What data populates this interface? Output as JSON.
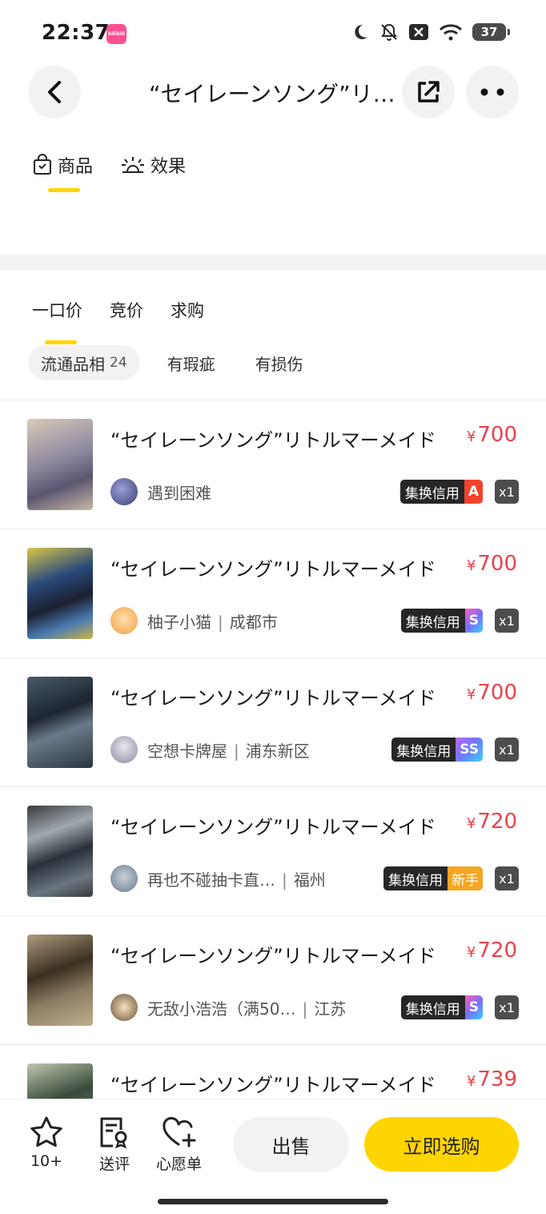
{
  "status_bar": {
    "time": "22:37",
    "app_badge": "bilibili",
    "battery": "37"
  },
  "header": {
    "title": "“セイレーンソング”リトルマーメイド"
  },
  "top_tabs": [
    {
      "label": "商品",
      "icon": "bag-icon",
      "active": true
    },
    {
      "label": "效果",
      "icon": "effect-icon",
      "active": false
    }
  ],
  "sub_tabs": [
    {
      "label": "一口价",
      "active": true
    },
    {
      "label": "竞价",
      "active": false
    },
    {
      "label": "求购",
      "active": false
    }
  ],
  "filters": [
    {
      "label": "流通品相",
      "count": "24",
      "active": true
    },
    {
      "label": "有瑕疵",
      "active": false
    },
    {
      "label": "有损伤",
      "active": false
    }
  ],
  "listings": [
    {
      "title": "“セイレーンソング”リトルマーメイド",
      "price": "700",
      "currency": "¥",
      "seller": "遇到困难",
      "location": "",
      "credit_label": "集换信用",
      "credit_level": "A",
      "qty": "x1"
    },
    {
      "title": "“セイレーンソング”リトルマーメイド",
      "price": "700",
      "currency": "¥",
      "seller": "柚子小猫",
      "location": "成都市",
      "credit_label": "集换信用",
      "credit_level": "S",
      "qty": "x1"
    },
    {
      "title": "“セイレーンソング”リトルマーメイド",
      "price": "700",
      "currency": "¥",
      "seller": "空想卡牌屋",
      "location": "浦东新区",
      "credit_label": "集换信用",
      "credit_level": "SS",
      "qty": "x1"
    },
    {
      "title": "“セイレーンソング”リトルマーメイド",
      "price": "720",
      "currency": "¥",
      "seller": "再也不碰抽卡直…",
      "location": "福州",
      "credit_label": "集换信用",
      "credit_level": "新手",
      "qty": "x1"
    },
    {
      "title": "“セイレーンソング”リトルマーメイド",
      "price": "720",
      "currency": "¥",
      "seller": "无敌小浩浩（满50…",
      "location": "江苏",
      "credit_label": "集换信用",
      "credit_level": "S",
      "qty": "x1"
    },
    {
      "title": "“セイレーンソング”リトルマーメイド",
      "price": "739",
      "currency": "¥"
    }
  ],
  "bottom_bar": {
    "favorite_label": "10+",
    "review_label": "送评",
    "wishlist_label": "心愿单",
    "sell_label": "出售",
    "buy_label": "立即选购"
  },
  "colors": {
    "accent": "#ffd500",
    "price": "#e8424a",
    "level_A": "#f0442e",
    "level_new": "#f5a623"
  }
}
